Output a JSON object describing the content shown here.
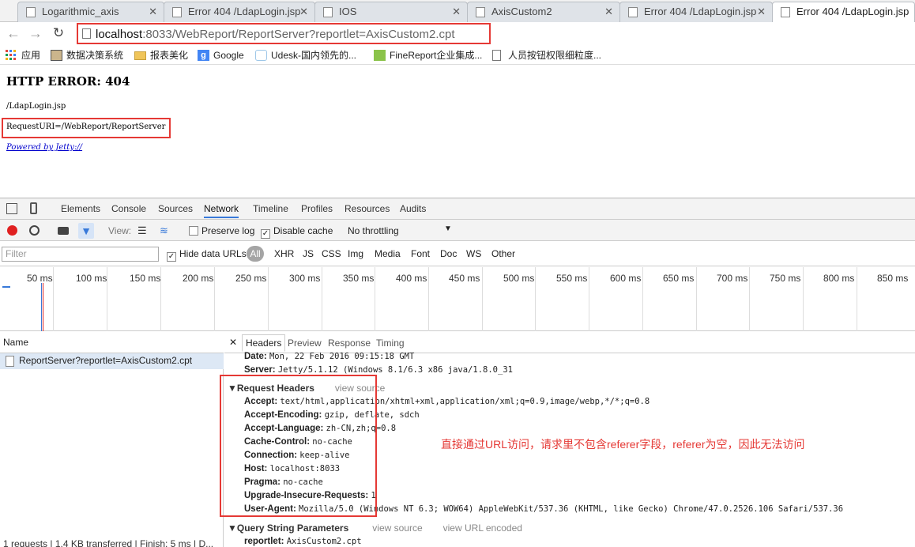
{
  "tabs": [
    {
      "title": "Logarithmic_axis",
      "active": false
    },
    {
      "title": "Error 404 /LdapLogin.jsp",
      "active": false
    },
    {
      "title": "IOS",
      "active": false
    },
    {
      "title": "AxisCustom2",
      "active": false
    },
    {
      "title": "Error 404 /LdapLogin.jsp",
      "active": false
    },
    {
      "title": "Error 404 /LdapLogin.jsp",
      "active": true
    }
  ],
  "address": {
    "host": "localhost",
    "rest": ":8033/WebReport/ReportServer?reportlet=AxisCustom2.cpt"
  },
  "bookmarks": [
    {
      "label": "应用",
      "icon": "apps-grid-icon"
    },
    {
      "label": "数据决策系统",
      "icon": "image-icon"
    },
    {
      "label": "报表美化",
      "icon": "folder-icon"
    },
    {
      "label": "Google",
      "icon": "google-icon"
    },
    {
      "label": "Udesk-国内领先的...",
      "icon": "udesk-icon"
    },
    {
      "label": "FineReport企业集成...",
      "icon": "finereport-icon"
    },
    {
      "label": "人员按钮权限细粒度...",
      "icon": "page-icon"
    }
  ],
  "page": {
    "heading": "HTTP ERROR: 404",
    "path": "/LdapLogin.jsp",
    "request_uri": "RequestURI=/WebReport/ReportServer",
    "powered_by": "Powered by Jetty://"
  },
  "devtools": {
    "panels": [
      "Elements",
      "Console",
      "Sources",
      "Network",
      "Timeline",
      "Profiles",
      "Resources",
      "Audits"
    ],
    "active_panel": "Network",
    "view_label": "View:",
    "preserve_log": "Preserve log",
    "disable_cache": "Disable cache",
    "throttling": "No throttling",
    "filter_placeholder": "Filter",
    "hide_data_urls": "Hide data URLs",
    "types": [
      "All",
      "XHR",
      "JS",
      "CSS",
      "Img",
      "Media",
      "Font",
      "Doc",
      "WS",
      "Other"
    ],
    "timeline_ticks": [
      "50 ms",
      "100 ms",
      "150 ms",
      "200 ms",
      "250 ms",
      "300 ms",
      "350 ms",
      "400 ms",
      "450 ms",
      "500 ms",
      "550 ms",
      "600 ms",
      "650 ms",
      "700 ms",
      "750 ms",
      "800 ms",
      "850 ms"
    ],
    "name_header": "Name",
    "request_name": "ReportServer?reportlet=AxisCustom2.cpt",
    "status": "1 requests | 1.4 KB transferred | Finish: 5 ms | D...",
    "detail_tabs": [
      "Headers",
      "Preview",
      "Response",
      "Timing"
    ],
    "response_headers": [
      {
        "k": "Date:",
        "v": "Mon, 22 Feb 2016 09:15:18 GMT"
      },
      {
        "k": "Server:",
        "v": "Jetty/5.1.12 (Windows 8.1/6.3 x86 java/1.8.0_31"
      }
    ],
    "request_headers_title": "▼Request Headers",
    "view_source": "view source",
    "request_headers": [
      {
        "k": "Accept:",
        "v": "text/html,application/xhtml+xml,application/xml;q=0.9,image/webp,*/*;q=0.8"
      },
      {
        "k": "Accept-Encoding:",
        "v": "gzip, deflate, sdch"
      },
      {
        "k": "Accept-Language:",
        "v": "zh-CN,zh;q=0.8"
      },
      {
        "k": "Cache-Control:",
        "v": "no-cache"
      },
      {
        "k": "Connection:",
        "v": "keep-alive"
      },
      {
        "k": "Host:",
        "v": "localhost:8033"
      },
      {
        "k": "Pragma:",
        "v": "no-cache"
      },
      {
        "k": "Upgrade-Insecure-Requests:",
        "v": "1"
      },
      {
        "k": "User-Agent:",
        "v": "Mozilla/5.0 (Windows NT 6.3; WOW64) AppleWebKit/537.36 (KHTML, like Gecko) Chrome/47.0.2526.106 Safari/537.36"
      }
    ],
    "query_title": "▼Query String Parameters",
    "view_url_encoded": "view URL encoded",
    "query_params": [
      {
        "k": "reportlet:",
        "v": "AxisCustom2.cpt"
      }
    ]
  },
  "annotation": "直接通过URL访问，请求里不包含referer字段，referer为空，因此无法访问",
  "colors": {
    "highlight": "#e53935",
    "link": "#0000cc",
    "active_tab_underline": "#3879d9"
  }
}
